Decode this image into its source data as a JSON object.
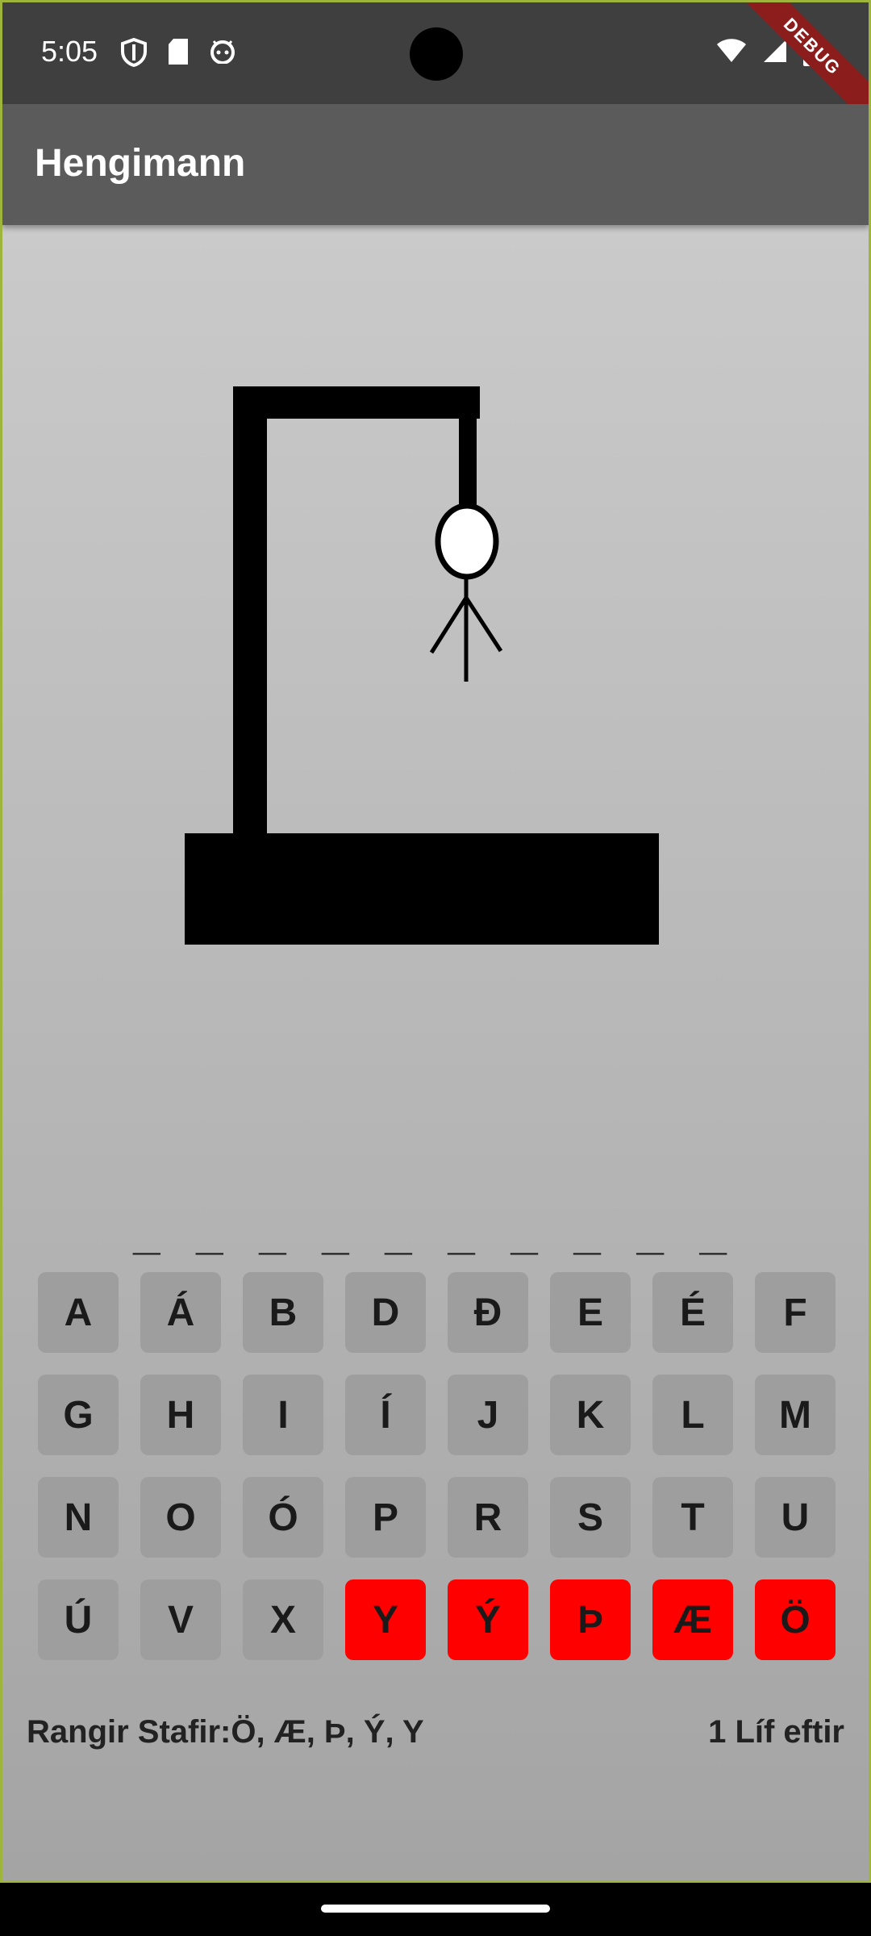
{
  "status_bar": {
    "time": "5:05",
    "left_icons": [
      "shield-icon",
      "sd-card-icon",
      "android-head-icon"
    ],
    "right_icons": [
      "wifi-icon",
      "signal-icon",
      "battery-icon"
    ]
  },
  "debug_banner": "DEBUG",
  "app_bar": {
    "title": "Hengimann"
  },
  "word_blanks": "_ _ _ _ _ _ _ _ _ _",
  "keyboard": {
    "keys": [
      {
        "label": "A",
        "state": "normal"
      },
      {
        "label": "Á",
        "state": "normal"
      },
      {
        "label": "B",
        "state": "normal"
      },
      {
        "label": "D",
        "state": "normal"
      },
      {
        "label": "Ð",
        "state": "normal"
      },
      {
        "label": "E",
        "state": "normal"
      },
      {
        "label": "É",
        "state": "normal"
      },
      {
        "label": "F",
        "state": "normal"
      },
      {
        "label": "G",
        "state": "normal"
      },
      {
        "label": "H",
        "state": "normal"
      },
      {
        "label": "I",
        "state": "normal"
      },
      {
        "label": "Í",
        "state": "normal"
      },
      {
        "label": "J",
        "state": "normal"
      },
      {
        "label": "K",
        "state": "normal"
      },
      {
        "label": "L",
        "state": "normal"
      },
      {
        "label": "M",
        "state": "normal"
      },
      {
        "label": "N",
        "state": "normal"
      },
      {
        "label": "O",
        "state": "normal"
      },
      {
        "label": "Ó",
        "state": "normal"
      },
      {
        "label": "P",
        "state": "normal"
      },
      {
        "label": "R",
        "state": "normal"
      },
      {
        "label": "S",
        "state": "normal"
      },
      {
        "label": "T",
        "state": "normal"
      },
      {
        "label": "U",
        "state": "normal"
      },
      {
        "label": "Ú",
        "state": "normal"
      },
      {
        "label": "V",
        "state": "normal"
      },
      {
        "label": "X",
        "state": "normal"
      },
      {
        "label": "Y",
        "state": "wrong"
      },
      {
        "label": "Ý",
        "state": "wrong"
      },
      {
        "label": "Þ",
        "state": "wrong"
      },
      {
        "label": "Æ",
        "state": "wrong"
      },
      {
        "label": "Ö",
        "state": "wrong"
      }
    ],
    "wrong_color": "#ff0000",
    "normal_color": "#9e9e9e"
  },
  "footer": {
    "wrong_letters": "Rangir Stafir:Ö, Æ, Þ, Ý, Y",
    "lives_left": "1 Líf eftir"
  }
}
